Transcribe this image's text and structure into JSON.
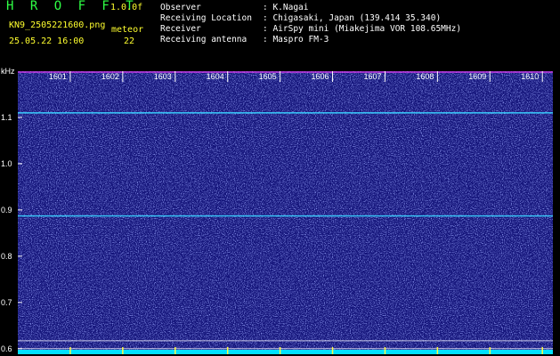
{
  "header": {
    "app_title": "H R O F F T",
    "version": "1.0.0f",
    "filename": "KN9_2505221600.png",
    "mode": "meteor",
    "timestamp": "25.05.22 16:00",
    "count": "22"
  },
  "station_info": [
    {
      "label": "Observer",
      "value": ": K.Nagai"
    },
    {
      "label": "Receiving Location",
      "value": ": Chigasaki, Japan (139.414 35.340)"
    },
    {
      "label": "Receiver",
      "value": ": AirSpy mini (Miakejima VOR 108.65MHz)"
    },
    {
      "label": "Receiving antenna",
      "value": ": Maspro FM-3"
    }
  ],
  "colors": {
    "background": "#000000",
    "plot_background": "#14147a",
    "title_green": "#2fff45",
    "header_yellow": "#ffff2e",
    "text_white": "#ffffff",
    "trace_cyan": "#3ad0ff",
    "baseline_cyan": "#00e0ff",
    "tick_magenta": "#ff40ff"
  },
  "chart_data": {
    "type": "heatmap",
    "y_unit": "kHz",
    "y_ticks": [
      "1.1",
      "1.0",
      "0.9",
      "0.8",
      "0.7",
      "0.6"
    ],
    "x_ticks": [
      "1601",
      "1602",
      "1603",
      "1604",
      "1605",
      "1606",
      "1607",
      "1608",
      "1609",
      "1610"
    ],
    "x_range": [
      1600,
      1610.2
    ],
    "y_range": [
      0.588,
      1.2
    ],
    "horizontal_traces": [
      {
        "freq_khz": 1.11,
        "color": "#3ad0ff"
      },
      {
        "freq_khz": 0.887,
        "color": "#3ad0ff"
      }
    ],
    "reference_lines_khz": [
      0.617,
      0.6
    ],
    "grid": false
  }
}
